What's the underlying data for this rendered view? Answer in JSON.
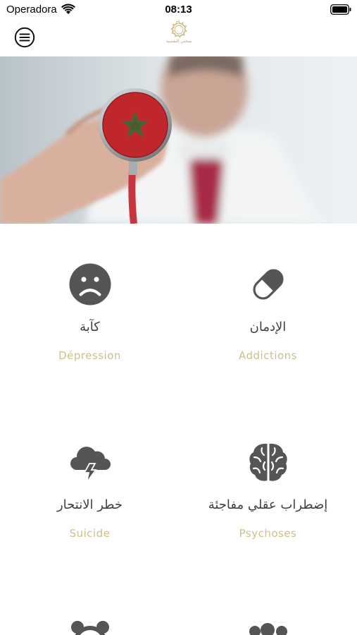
{
  "status_bar": {
    "carrier": "Operadora",
    "time": "08:13",
    "icons": [
      "wifi-icon",
      "battery-icon"
    ]
  },
  "nav": {
    "menu_icon": "hamburger-menu-icon",
    "logo_icon": "sun-ornament-logo",
    "logo_text": "صحتي النفسية"
  },
  "hero": {
    "description": "doctor-with-moroccan-flag-stethoscope"
  },
  "categories": [
    {
      "icon": "sad-face-icon",
      "arabic": "كآبة",
      "french": "Dépression"
    },
    {
      "icon": "pill-capsule-icon",
      "arabic": "الإدمان",
      "french": "Addictions"
    },
    {
      "icon": "storm-cloud-icon",
      "arabic": "خطر الانتحار",
      "french": "Suicide"
    },
    {
      "icon": "brain-icon",
      "arabic": "إضطراب عقلي مفاجئة",
      "french": "Psychoses"
    }
  ],
  "colors": {
    "accent_gold": "#cdbf8a",
    "icon_gray": "#555555",
    "text_dark": "#3f3f3f",
    "flag_red": "#c0272d",
    "flag_star": "#3d6b35"
  }
}
